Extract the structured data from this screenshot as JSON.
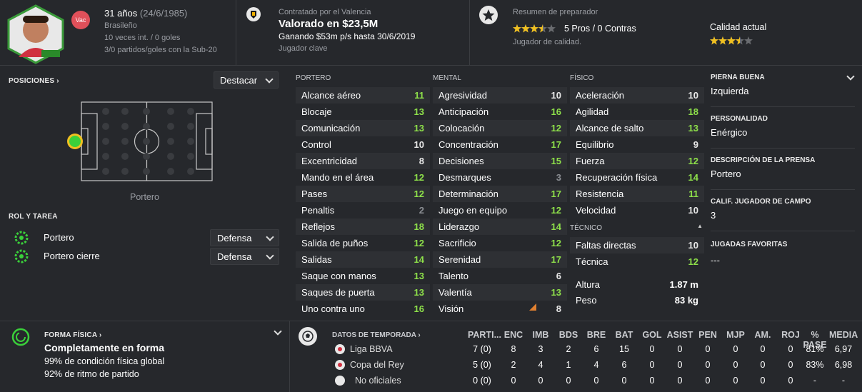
{
  "player": {
    "age": "31 años",
    "dob": "(24/6/1985)",
    "nationality": "Brasileño",
    "intl": "10 veces int. / 0 goles",
    "u20": "3/0 partidos/goles con la Sub-20",
    "badge": "Vac"
  },
  "contract": {
    "club_line": "Contratado por el Valencia",
    "value": "Valorado en $23,5M",
    "wage": "Ganando $53m p/s hasta 30/6/2019",
    "status": "Jugador clave"
  },
  "coach": {
    "title": "Resumen de preparador",
    "pros": "5 Pros / 0 Contras",
    "quality": "Jugador de calidad.",
    "current_label": "Calidad actual",
    "stars_summary": 3.5,
    "stars_current": 3.5
  },
  "positions": {
    "label": "POSICIONES",
    "dropdown": "Destacar",
    "position_name": "Portero"
  },
  "roles": {
    "label": "ROL Y TAREA",
    "items": [
      {
        "name": "Portero",
        "duty": "Defensa"
      },
      {
        "name": "Portero cierre",
        "duty": "Defensa"
      }
    ]
  },
  "attributes": {
    "goalkeeping": {
      "header": "PORTERO",
      "rows": [
        {
          "n": "Alcance aéreo",
          "v": "11",
          "c": "g"
        },
        {
          "n": "Blocaje",
          "v": "13",
          "c": "g"
        },
        {
          "n": "Comunicación",
          "v": "13",
          "c": "g"
        },
        {
          "n": "Control",
          "v": "10",
          "c": "w"
        },
        {
          "n": "Excentricidad",
          "v": "8",
          "c": "w"
        },
        {
          "n": "Mando en el área",
          "v": "12",
          "c": "g"
        },
        {
          "n": "Pases",
          "v": "12",
          "c": "g"
        },
        {
          "n": "Penaltis",
          "v": "2",
          "c": "d"
        },
        {
          "n": "Reflejos",
          "v": "18",
          "c": "g"
        },
        {
          "n": "Salida de puños",
          "v": "12",
          "c": "g"
        },
        {
          "n": "Salidas",
          "v": "14",
          "c": "g"
        },
        {
          "n": "Saque con manos",
          "v": "13",
          "c": "g"
        },
        {
          "n": "Saques de puerta",
          "v": "13",
          "c": "g"
        },
        {
          "n": "Uno contra uno",
          "v": "16",
          "c": "g"
        }
      ]
    },
    "mental": {
      "header": "MENTAL",
      "rows": [
        {
          "n": "Agresividad",
          "v": "10",
          "c": "w"
        },
        {
          "n": "Anticipación",
          "v": "16",
          "c": "g"
        },
        {
          "n": "Colocación",
          "v": "12",
          "c": "g"
        },
        {
          "n": "Concentración",
          "v": "17",
          "c": "g"
        },
        {
          "n": "Decisiones",
          "v": "15",
          "c": "g"
        },
        {
          "n": "Desmarques",
          "v": "3",
          "c": "d"
        },
        {
          "n": "Determinación",
          "v": "17",
          "c": "g"
        },
        {
          "n": "Juego en equipo",
          "v": "12",
          "c": "g"
        },
        {
          "n": "Liderazgo",
          "v": "14",
          "c": "g"
        },
        {
          "n": "Sacrificio",
          "v": "12",
          "c": "g"
        },
        {
          "n": "Serenidad",
          "v": "17",
          "c": "g"
        },
        {
          "n": "Talento",
          "v": "6",
          "c": "w"
        },
        {
          "n": "Valentía",
          "v": "13",
          "c": "g"
        },
        {
          "n": "Visión",
          "v": "8",
          "c": "w"
        }
      ]
    },
    "physical": {
      "header": "FÍSICO",
      "rows": [
        {
          "n": "Aceleración",
          "v": "10",
          "c": "w"
        },
        {
          "n": "Agilidad",
          "v": "18",
          "c": "g"
        },
        {
          "n": "Alcance de salto",
          "v": "13",
          "c": "g"
        },
        {
          "n": "Equilibrio",
          "v": "9",
          "c": "w"
        },
        {
          "n": "Fuerza",
          "v": "12",
          "c": "g"
        },
        {
          "n": "Recuperación física",
          "v": "14",
          "c": "g"
        },
        {
          "n": "Resistencia",
          "v": "11",
          "c": "g"
        },
        {
          "n": "Velocidad",
          "v": "10",
          "c": "w"
        }
      ]
    },
    "technical": {
      "header": "TÉCNICO",
      "rows": [
        {
          "n": "Faltas directas",
          "v": "10",
          "c": "w"
        },
        {
          "n": "Técnica",
          "v": "12",
          "c": "g"
        }
      ]
    },
    "height_label": "Altura",
    "height": "1.87 m",
    "weight_label": "Peso",
    "weight": "83 kg"
  },
  "side": {
    "foot_label": "PIERNA BUENA",
    "foot": "Izquierda",
    "personality_label": "PERSONALIDAD",
    "personality": "Enérgico",
    "press_label": "DESCRIPCIÓN DE LA PRENSA",
    "press": "Portero",
    "outfield_label": "CALIF. JUGADOR DE CAMPO",
    "outfield": "3",
    "moves_label": "JUGADAS FAVORITAS",
    "moves": "---"
  },
  "fitness": {
    "label": "FORMA FÍSICA",
    "status": "Completamente en forma",
    "condition": "99% de condición física global",
    "sharpness": "92% de ritmo de partido"
  },
  "season": {
    "label": "DATOS DE TEMPORADA",
    "columns": [
      "PARTI...",
      "ENC",
      "IMB",
      "BDS",
      "BRE",
      "BAT",
      "GOL",
      "ASIST",
      "PEN",
      "MJP",
      "AM.",
      "ROJ",
      "% PASE",
      "MEDIA"
    ],
    "rows": [
      {
        "comp": "Liga BBVA",
        "vals": [
          "7 (0)",
          "8",
          "3",
          "2",
          "6",
          "15",
          "0",
          "0",
          "0",
          "0",
          "0",
          "0",
          "81%",
          "6,97"
        ]
      },
      {
        "comp": "Copa del Rey",
        "vals": [
          "5 (0)",
          "2",
          "4",
          "1",
          "4",
          "6",
          "0",
          "0",
          "0",
          "0",
          "0",
          "0",
          "83%",
          "6,98"
        ]
      },
      {
        "comp": "No oficiales",
        "vals": [
          "0 (0)",
          "0",
          "0",
          "0",
          "0",
          "0",
          "0",
          "0",
          "0",
          "0",
          "0",
          "0",
          "-",
          "-"
        ]
      }
    ]
  },
  "colors": {
    "green": "#8ee04a",
    "accent_red": "#e0505a",
    "bg": "#26282c"
  }
}
